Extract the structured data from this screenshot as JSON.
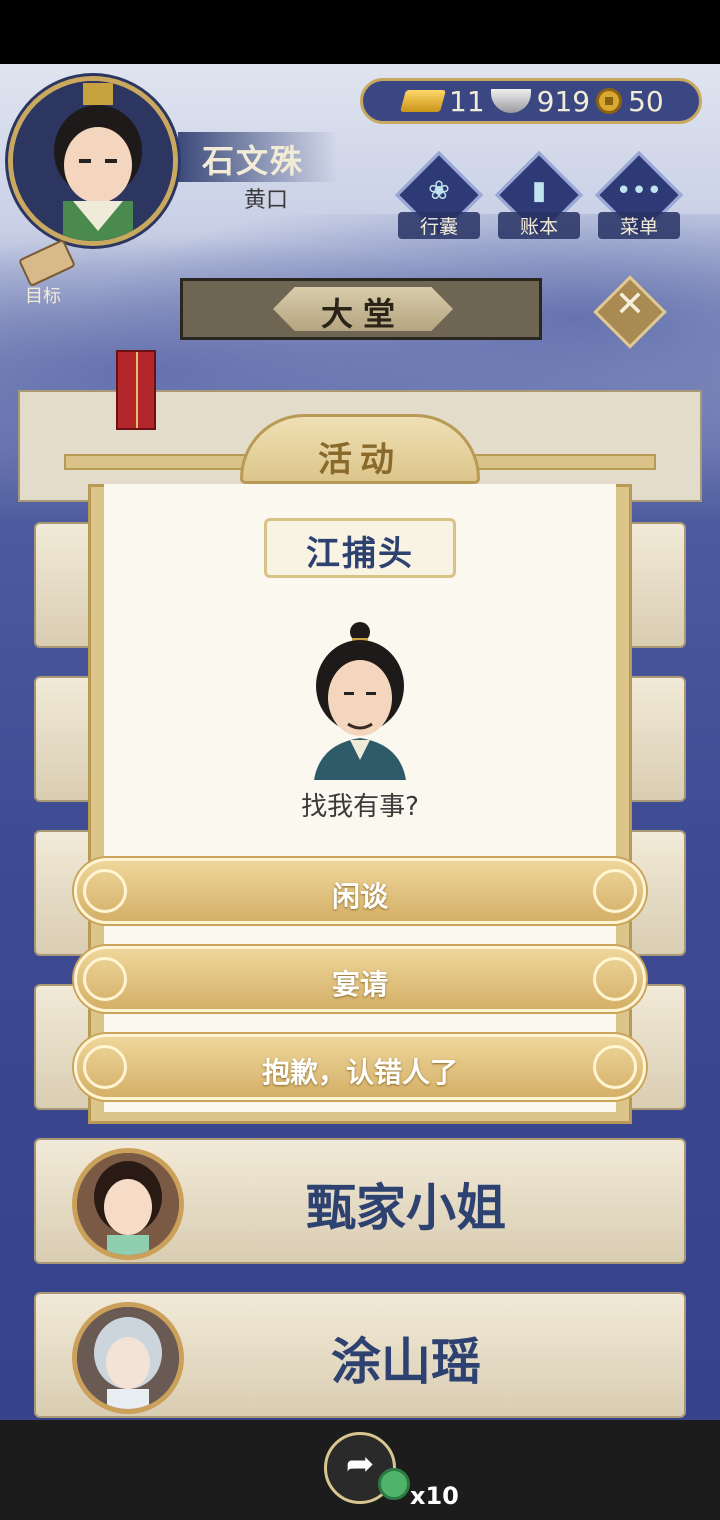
{
  "player": {
    "name": "石文殊",
    "rank": "黄口"
  },
  "currency": {
    "gold": "11",
    "silver": "919",
    "coins": "50"
  },
  "top_buttons": [
    {
      "label": "行囊",
      "icon": "bag-icon"
    },
    {
      "label": "账本",
      "icon": "ledger-icon"
    },
    {
      "label": "菜单",
      "icon": "menu-icon"
    }
  ],
  "goal_label": "目标",
  "hall_title": "大堂",
  "list_cards": [
    {
      "name": "甄家小姐"
    },
    {
      "name": "涂山瑶"
    }
  ],
  "modal": {
    "title": "活动",
    "npc_name": "江捕头",
    "npc_line": "找我有事?",
    "options": [
      "闲谈",
      "宴请",
      "抱歉，认错人了"
    ]
  },
  "bottom": {
    "jade_count": "x10"
  },
  "colors": {
    "accent_gold": "#d4b068",
    "navy": "#2d4270",
    "paper": "#fbf8ef"
  }
}
